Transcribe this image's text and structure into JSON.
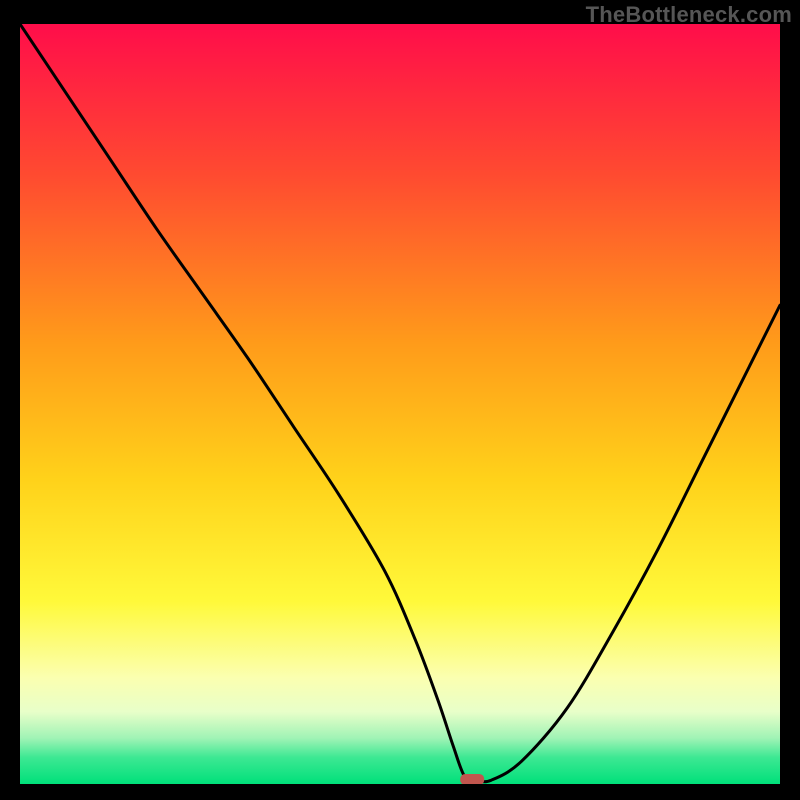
{
  "watermark": "TheBottleneck.com",
  "chart_data": {
    "type": "line",
    "title": "",
    "xlabel": "",
    "ylabel": "",
    "xlim": [
      0,
      100
    ],
    "ylim": [
      0,
      100
    ],
    "grid": false,
    "legend": false,
    "series": [
      {
        "name": "curve",
        "x": [
          0,
          6,
          12,
          18,
          24,
          30,
          36,
          42,
          48,
          52,
          55,
          57,
          58.5,
          60,
          62,
          66,
          72,
          78,
          84,
          90,
          96,
          100
        ],
        "y": [
          100,
          91,
          82,
          73,
          64.5,
          56,
          47,
          38,
          28,
          19,
          11,
          5,
          1,
          0.5,
          0.5,
          3,
          10,
          20,
          31,
          43,
          55,
          63
        ]
      }
    ],
    "marker": {
      "x": 59.5,
      "y": 0.6
    },
    "background_gradient": {
      "stops": [
        {
          "offset": 0.0,
          "color": "#ff0d4a"
        },
        {
          "offset": 0.2,
          "color": "#ff4b30"
        },
        {
          "offset": 0.42,
          "color": "#ff9b1a"
        },
        {
          "offset": 0.6,
          "color": "#ffd21a"
        },
        {
          "offset": 0.76,
          "color": "#fff93a"
        },
        {
          "offset": 0.86,
          "color": "#fbffb0"
        },
        {
          "offset": 0.905,
          "color": "#e8ffc9"
        },
        {
          "offset": 0.94,
          "color": "#9ff3b5"
        },
        {
          "offset": 0.965,
          "color": "#3de893"
        },
        {
          "offset": 1.0,
          "color": "#00e07a"
        }
      ]
    },
    "marker_color": "#c1564e",
    "curve_color": "#000000"
  }
}
